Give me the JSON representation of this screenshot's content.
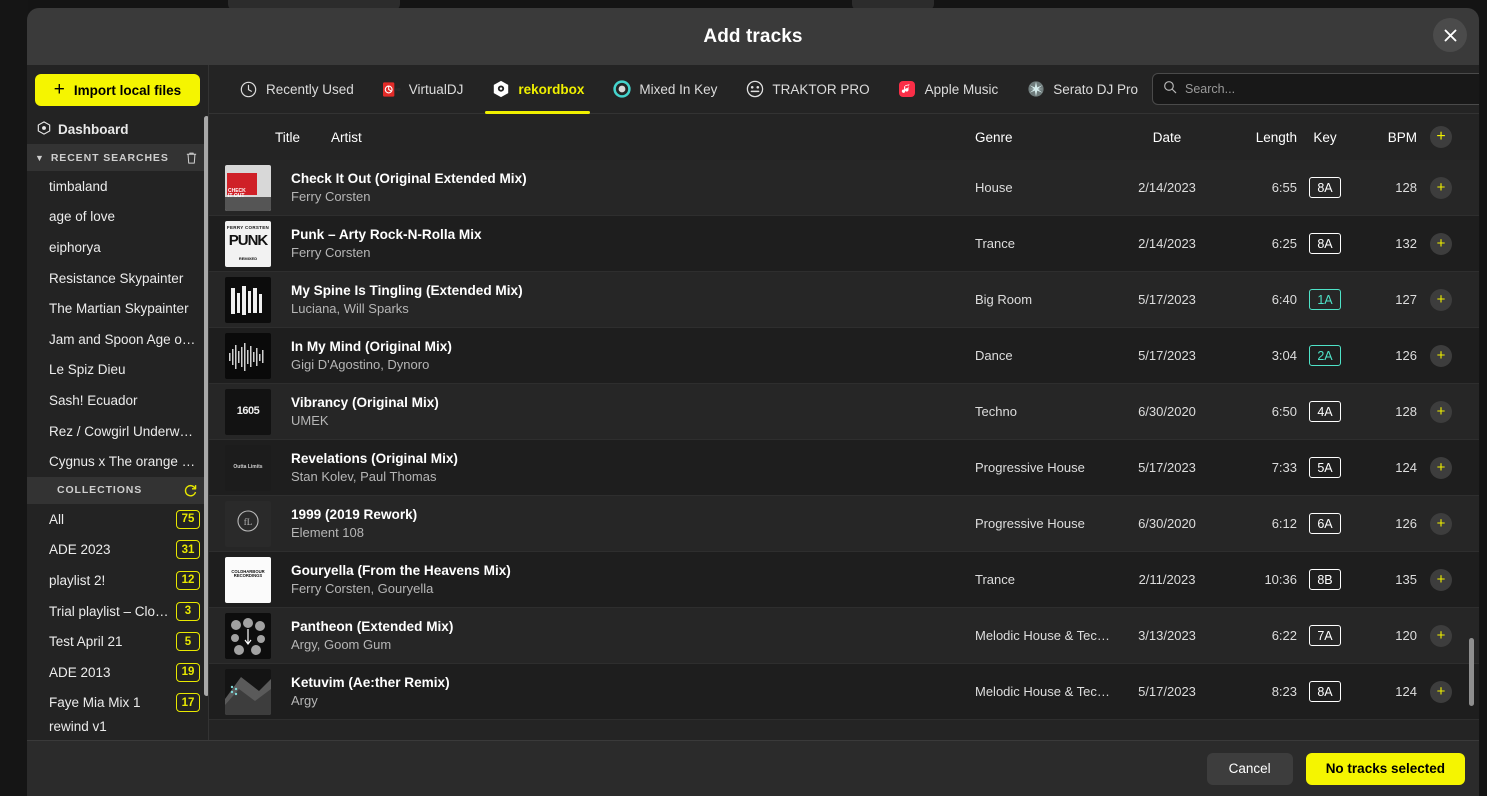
{
  "window": {
    "title": "Add tracks",
    "close_icon": "close-icon"
  },
  "sidebar": {
    "import_button": "Import local files",
    "dashboard": "Dashboard",
    "recent_searches_header": "RECENT SEARCHES",
    "recent_searches_action_icon": "trash-icon",
    "recent_searches": [
      "timbaland",
      "age of love",
      "eiphorya",
      "Resistance Skypainter",
      "The Martian Skypainter",
      "Jam and Spoon Age o…",
      "Le Spiz Dieu",
      "Sash! Ecuador",
      "Rez / Cowgirl Underw…",
      "Cygnus x The orange …"
    ],
    "collections_header": "COLLECTIONS",
    "collections_action_icon": "refresh-icon",
    "collections": [
      {
        "label": "All",
        "count": "75"
      },
      {
        "label": "ADE 2023",
        "count": "31"
      },
      {
        "label": "playlist 2!",
        "count": "12"
      },
      {
        "label": "Trial playlist – Clo…",
        "count": "3"
      },
      {
        "label": "Test April 21",
        "count": "5"
      },
      {
        "label": "ADE 2013",
        "count": "19"
      },
      {
        "label": "Faye Mia Mix 1",
        "count": "17"
      },
      {
        "label": "rewind v1",
        "count": ""
      }
    ]
  },
  "tabs": [
    {
      "label": "Recently Used",
      "icon": "clock-icon",
      "active": false
    },
    {
      "label": "VirtualDJ",
      "icon": "virtualdj-icon",
      "active": false
    },
    {
      "label": "rekordbox",
      "icon": "rekordbox-icon",
      "active": true
    },
    {
      "label": "Mixed In Key",
      "icon": "mixedinkey-icon",
      "active": false
    },
    {
      "label": "TRAKTOR PRO",
      "icon": "traktor-icon",
      "active": false
    },
    {
      "label": "Apple Music",
      "icon": "apple-music-icon",
      "active": false
    },
    {
      "label": "Serato DJ Pro",
      "icon": "serato-icon",
      "active": false
    }
  ],
  "search": {
    "placeholder": "Search...",
    "value": "",
    "icon": "search-icon"
  },
  "table": {
    "columns": {
      "title": "Title",
      "artist": "Artist",
      "genre": "Genre",
      "date": "Date",
      "length": "Length",
      "key": "Key",
      "bpm": "BPM",
      "add": "add-all-icon"
    },
    "rows": [
      {
        "title": "Check It Out (Original Extended Mix)",
        "artist": "Ferry Corsten",
        "genre": "House",
        "date": "2/14/2023",
        "length": "6:55",
        "key": "8A",
        "key_color": "#ffffff",
        "bpm": "128",
        "art": {
          "bg": "#d8d8d8",
          "accent": "#cf2027",
          "text": "CHECK IT OUT"
        }
      },
      {
        "title": "Punk – Arty Rock-N-Rolla Mix",
        "artist": "Ferry Corsten",
        "genre": "Trance",
        "date": "2/14/2023",
        "length": "6:25",
        "key": "8A",
        "key_color": "#ffffff",
        "bpm": "132",
        "art": {
          "bg": "#f2f2f2",
          "accent": "#1a1a1a",
          "text": "PUNK"
        }
      },
      {
        "title": "My Spine Is Tingling (Extended Mix)",
        "artist": "Luciana, Will Sparks",
        "genre": "Big Room",
        "date": "5/17/2023",
        "length": "6:40",
        "key": "1A",
        "key_color": "#4fe3c8",
        "bpm": "127",
        "art": {
          "bg": "#0c0c0c",
          "accent": "#f0f0f0",
          "text": ""
        }
      },
      {
        "title": "In My Mind (Original Mix)",
        "artist": "Gigi D'Agostino, Dynoro",
        "genre": "Dance",
        "date": "5/17/2023",
        "length": "3:04",
        "key": "2A",
        "key_color": "#4fe3c8",
        "bpm": "126",
        "art": {
          "bg": "#0a0a0a",
          "accent": "#d0d0d0",
          "text": ""
        }
      },
      {
        "title": "Vibrancy (Original Mix)",
        "artist": "UMEK",
        "genre": "Techno",
        "date": "6/30/2020",
        "length": "6:50",
        "key": "4A",
        "key_color": "#ffffff",
        "bpm": "128",
        "art": {
          "bg": "#121212",
          "accent": "#efefef",
          "text": "1605"
        }
      },
      {
        "title": "Revelations (Original Mix)",
        "artist": "Stan Kolev, Paul Thomas",
        "genre": "Progressive House",
        "date": "5/17/2023",
        "length": "7:33",
        "key": "5A",
        "key_color": "#ffffff",
        "bpm": "124",
        "art": {
          "bg": "#1c1c1c",
          "accent": "#cfcfcf",
          "text": "Outta Limits"
        }
      },
      {
        "title": "1999 (2019 Rework)",
        "artist": "Element 108",
        "genre": "Progressive House",
        "date": "6/30/2020",
        "length": "6:12",
        "key": "6A",
        "key_color": "#ffffff",
        "bpm": "126",
        "art": {
          "bg": "#2a2a2a",
          "accent": "#b8b8b8",
          "text": ""
        }
      },
      {
        "title": "Gouryella (From the Heavens Mix)",
        "artist": "Ferry Corsten, Gouryella",
        "genre": "Trance",
        "date": "2/11/2023",
        "length": "10:36",
        "key": "8B",
        "key_color": "#ffffff",
        "bpm": "135",
        "art": {
          "bg": "#fbfbfb",
          "accent": "#111111",
          "text": "COLDHARBOUR RECORDINGS"
        }
      },
      {
        "title": "Pantheon (Extended Mix)",
        "artist": "Argy, Goom Gum",
        "genre": "Melodic House & Tec…",
        "date": "3/13/2023",
        "length": "6:22",
        "key": "7A",
        "key_color": "#ffffff",
        "bpm": "120",
        "art": {
          "bg": "#0d0d0d",
          "accent": "#cccccc",
          "text": ""
        }
      },
      {
        "title": "Ketuvim (Ae:ther Remix)",
        "artist": "Argy",
        "genre": "Melodic House & Tec…",
        "date": "5/17/2023",
        "length": "8:23",
        "key": "8A",
        "key_color": "#ffffff",
        "bpm": "124",
        "art": {
          "bg": "#141414",
          "accent": "#7fd8d8",
          "text": ""
        }
      }
    ]
  },
  "footer": {
    "cancel": "Cancel",
    "primary": "No tracks selected"
  },
  "colors": {
    "accent_yellow": "#f5f500",
    "key_teal": "#4fe3c8",
    "modal_bg": "#232323"
  }
}
